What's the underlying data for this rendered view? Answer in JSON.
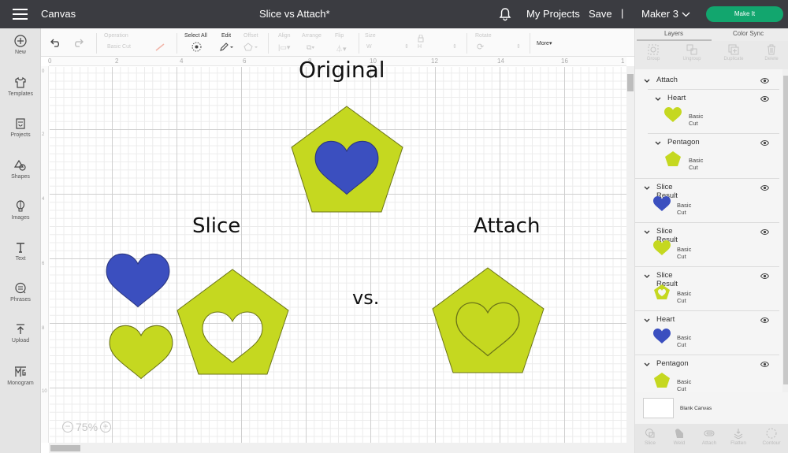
{
  "topbar": {
    "app_title": "Canvas",
    "document_title": "Slice vs Attach*",
    "my_projects": "My Projects",
    "save": "Save",
    "separator": "|",
    "machine": "Maker 3",
    "make_it": "Make It",
    "make_it_color": "#12a66e"
  },
  "sidebar": {
    "items": [
      {
        "label": "New",
        "icon": "plus-circle-icon"
      },
      {
        "label": "Templates",
        "icon": "shirt-icon"
      },
      {
        "label": "Projects",
        "icon": "projects-icon"
      },
      {
        "label": "Shapes",
        "icon": "shapes-icon"
      },
      {
        "label": "Images",
        "icon": "balloon-icon"
      },
      {
        "label": "Text",
        "icon": "text-icon"
      },
      {
        "label": "Phrases",
        "icon": "speech-bubble-icon"
      },
      {
        "label": "Upload",
        "icon": "upload-icon"
      },
      {
        "label": "Monogram",
        "icon": "monogram-icon"
      }
    ]
  },
  "toolbar": {
    "operation_label": "Operation",
    "operation_value": "Basic Cut",
    "select_all": "Select All",
    "edit": "Edit",
    "offset": "Offset",
    "align": "Align",
    "arrange": "Arrange",
    "flip": "Flip",
    "size": "Size",
    "size_w": "W",
    "size_h": "H",
    "rotate": "Rotate",
    "more": "More▾"
  },
  "canvas": {
    "ruler_top": [
      "0",
      "2",
      "4",
      "6",
      "8",
      "10",
      "12",
      "14",
      "16",
      "1"
    ],
    "ruler_left": [
      "0",
      "2",
      "4",
      "6",
      "8",
      "10"
    ],
    "zoom_level": "75%",
    "labels": {
      "original": "Original",
      "slice": "Slice",
      "attach": "Attach",
      "vs": "vs."
    },
    "colors": {
      "lime": "#c5d820",
      "blue": "#3b4fbf",
      "outline": "#6b7418"
    }
  },
  "panel": {
    "tabs": [
      "Layers",
      "Color Sync"
    ],
    "layer_tools": [
      "Group",
      "Ungroup",
      "Duplicate",
      "Delete"
    ],
    "layers": [
      {
        "name": "Attach",
        "level": 0
      },
      {
        "name": "Heart",
        "level": 1,
        "op": "Basic Cut",
        "thumb": "heart",
        "color": "lime"
      },
      {
        "name": "Pentagon",
        "level": 1,
        "op": "Basic Cut",
        "thumb": "pentagon",
        "color": "lime"
      },
      {
        "name": "Slice Result",
        "level": 0,
        "op": "Basic Cut",
        "thumb": "heart",
        "color": "blue"
      },
      {
        "name": "Slice Result",
        "level": 0,
        "op": "Basic Cut",
        "thumb": "heart",
        "color": "lime"
      },
      {
        "name": "Slice Result",
        "level": 0,
        "op": "Basic Cut",
        "thumb": "pentagon-cutout",
        "color": "lime"
      },
      {
        "name": "Heart",
        "level": 0,
        "op": "Basic Cut",
        "thumb": "heart",
        "color": "blue"
      },
      {
        "name": "Pentagon",
        "level": 0,
        "op": "Basic Cut",
        "thumb": "pentagon",
        "color": "lime"
      }
    ],
    "blank_canvas": "Blank Canvas",
    "bottom_tools": [
      "Slice",
      "Weld",
      "Attach",
      "Flatten",
      "Contour"
    ]
  }
}
